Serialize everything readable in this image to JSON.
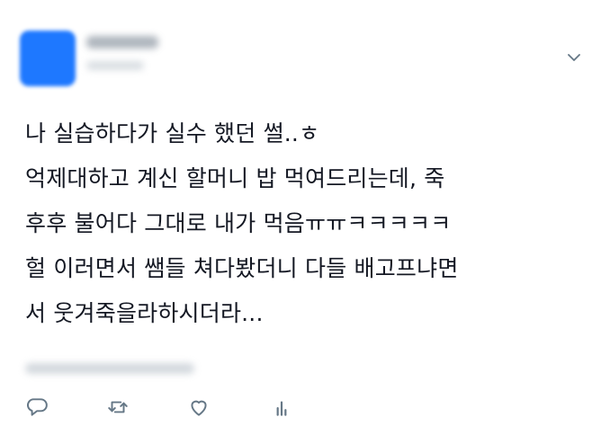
{
  "tweet": {
    "lines": [
      "나 실습하다가 실수 했던 썰..ㅎ",
      "억제대하고 계신 할머니 밥 먹여드리는데, 죽",
      "후후 불어다 그대로 내가 먹음ㅠㅠㅋㅋㅋㅋㅋ",
      "헐 이러면서 쌤들 쳐다봤더니 다들 배고프냐면",
      "서 웃겨죽을라하시더라..."
    ]
  },
  "icons": {
    "more": "chevron-down-icon",
    "reply": "reply-icon",
    "retweet": "retweet-icon",
    "like": "heart-icon",
    "stats": "analytics-icon"
  },
  "colors": {
    "avatar": "#1e78ff",
    "text": "#141823",
    "icon": "#657786"
  }
}
